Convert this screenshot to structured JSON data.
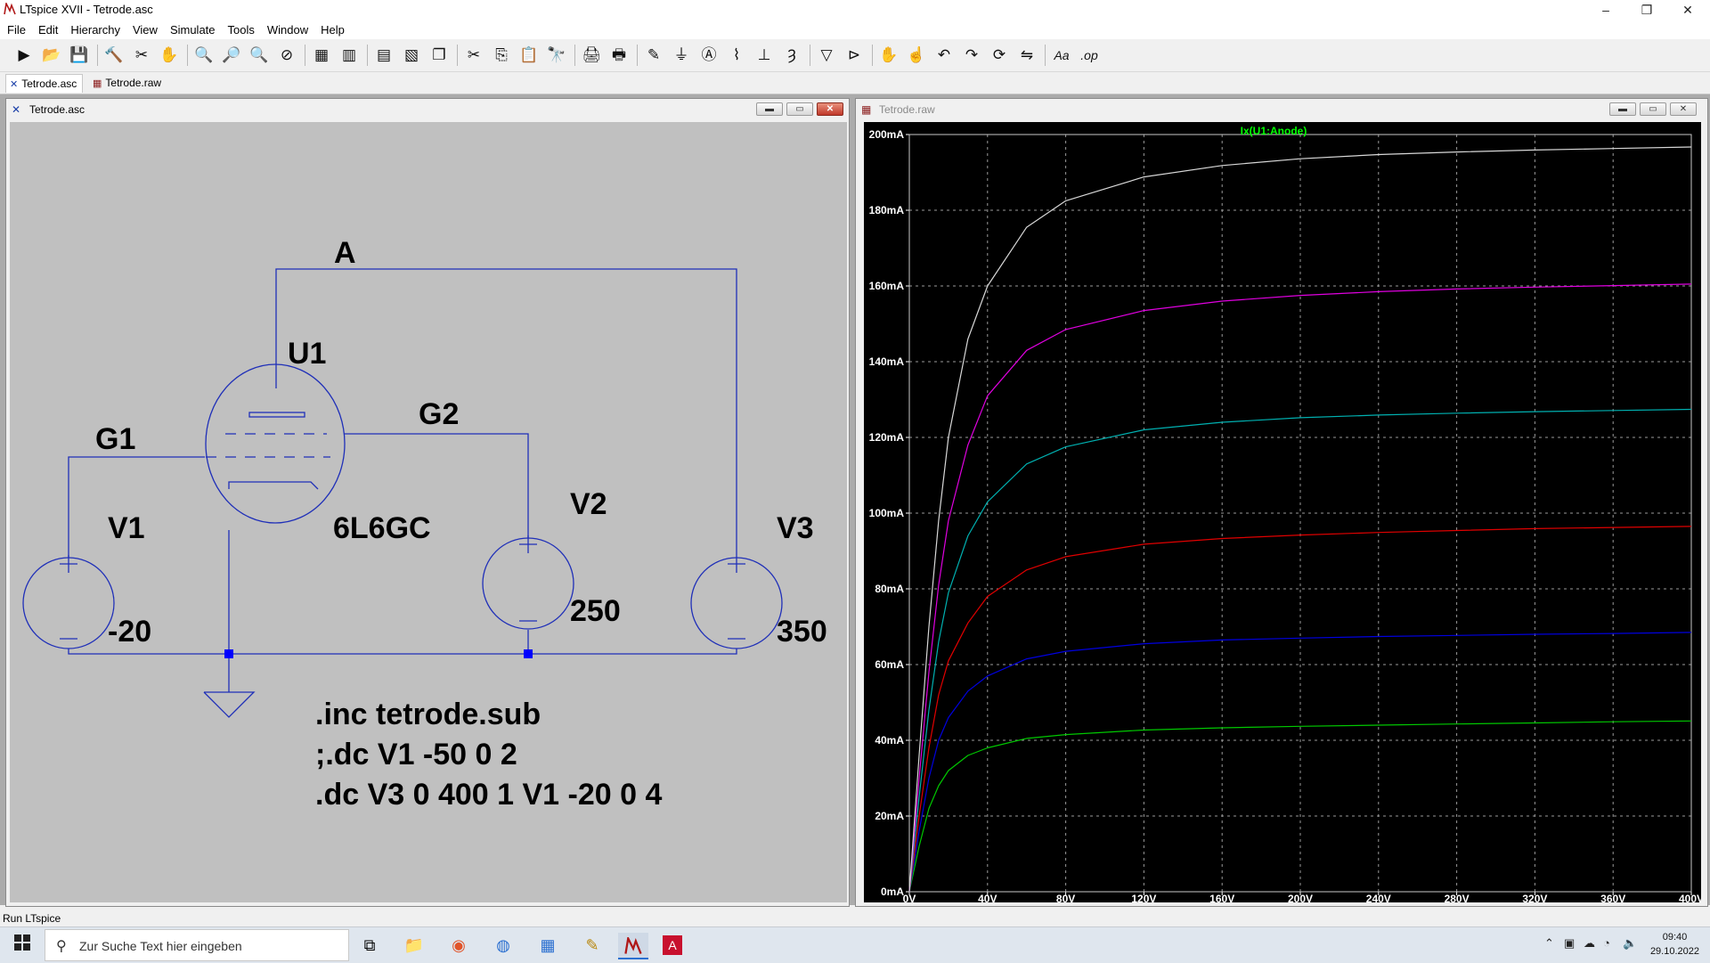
{
  "app": {
    "title": "LTspice XVII - Tetrode.asc",
    "window_controls": {
      "minimize": "–",
      "maximize": "❐",
      "close": "✕"
    }
  },
  "menu": [
    "File",
    "Edit",
    "Hierarchy",
    "View",
    "Simulate",
    "Tools",
    "Window",
    "Help"
  ],
  "toolbar": [
    {
      "name": "run-icon",
      "glyph": "▶"
    },
    {
      "name": "open-icon",
      "glyph": "📂"
    },
    {
      "name": "save-icon",
      "glyph": "💾"
    },
    {
      "name": "control-panel-icon",
      "glyph": "🔨"
    },
    {
      "name": "halt-icon",
      "glyph": "✂"
    },
    {
      "name": "pan-icon",
      "glyph": "✋"
    },
    {
      "name": "zoom-in-icon",
      "glyph": "🔍"
    },
    {
      "name": "zoom-full-icon",
      "glyph": "🔎"
    },
    {
      "name": "zoom-out-icon",
      "glyph": "🔍"
    },
    {
      "name": "zoom-cancel-icon",
      "glyph": "⊘"
    },
    {
      "name": "autorange-icon",
      "glyph": "▦"
    },
    {
      "name": "plot-settings-icon",
      "glyph": "▥"
    },
    {
      "name": "tile-horizontal-icon",
      "glyph": "▤"
    },
    {
      "name": "tile-vertical-icon",
      "glyph": "▧"
    },
    {
      "name": "cascade-icon",
      "glyph": "❐"
    },
    {
      "name": "cut-icon",
      "glyph": "✂"
    },
    {
      "name": "copy-icon",
      "glyph": "⎘"
    },
    {
      "name": "paste-icon",
      "glyph": "📋"
    },
    {
      "name": "find-icon",
      "glyph": "🔭"
    },
    {
      "name": "print-icon",
      "glyph": "🖨"
    },
    {
      "name": "print-preview-icon",
      "glyph": "🖶"
    },
    {
      "name": "wire-icon",
      "glyph": "✎"
    },
    {
      "name": "ground-icon",
      "glyph": "⏚"
    },
    {
      "name": "label-net-icon",
      "glyph": "Ⓐ"
    },
    {
      "name": "resistor-icon",
      "glyph": "⌇"
    },
    {
      "name": "capacitor-icon",
      "glyph": "⊥"
    },
    {
      "name": "inductor-icon",
      "glyph": "Ȝ"
    },
    {
      "name": "diode-icon",
      "glyph": "▽"
    },
    {
      "name": "component-icon",
      "glyph": "⊳"
    },
    {
      "name": "move-icon",
      "glyph": "✋"
    },
    {
      "name": "drag-icon",
      "glyph": "☝"
    },
    {
      "name": "undo-icon",
      "glyph": "↶"
    },
    {
      "name": "redo-icon",
      "glyph": "↷"
    },
    {
      "name": "rotate-icon",
      "glyph": "⟳"
    },
    {
      "name": "mirror-icon",
      "glyph": "⇋"
    },
    {
      "name": "text-icon",
      "glyph": "Aa"
    },
    {
      "name": "spice-directive-icon",
      "glyph": ".op"
    }
  ],
  "tabs": [
    {
      "label": "Tetrode.asc",
      "active": true
    },
    {
      "label": "Tetrode.raw",
      "active": false
    }
  ],
  "schematic": {
    "title": "Tetrode.asc",
    "labels": {
      "A": "A",
      "U1": "U1",
      "G2": "G2",
      "G1": "G1",
      "V1": "V1",
      "V2": "V2",
      "V3": "V3",
      "model": "6L6GC",
      "v1val": "-20",
      "v2val": "250",
      "v3val": "350"
    },
    "directives": [
      ".inc tetrode.sub",
      ";.dc V1 -50 0 2",
      ".dc V3 0 400 1 V1 -20 0 4"
    ],
    "colors": {
      "background": "#c0c0c0",
      "wire": "#1f2fb8",
      "text": "#000000",
      "junction": "#0000ff"
    }
  },
  "plot": {
    "title": "Tetrode.raw",
    "colors": {
      "background": "#000000",
      "grid": "#9a9a9a",
      "axis_text": "#ffffff",
      "trace_label": "#00ff00"
    },
    "chart_data": {
      "type": "line",
      "title": "Ix(U1:Anode)",
      "xlabel": "",
      "ylabel": "",
      "xlim": [
        0,
        400
      ],
      "ylim": [
        0,
        200
      ],
      "x_ticks": [
        "0V",
        "40V",
        "80V",
        "120V",
        "160V",
        "200V",
        "240V",
        "280V",
        "320V",
        "360V",
        "400V"
      ],
      "y_ticks": [
        "0mA",
        "20mA",
        "40mA",
        "60mA",
        "80mA",
        "100mA",
        "120mA",
        "140mA",
        "160mA",
        "180mA",
        "200mA"
      ],
      "grid": true,
      "x": [
        0,
        5,
        10,
        15,
        20,
        30,
        40,
        60,
        80,
        120,
        160,
        200,
        240,
        280,
        320,
        360,
        400
      ],
      "series": [
        {
          "color": "#00c800",
          "values": [
            0,
            12,
            22,
            28,
            32,
            36,
            38,
            40.5,
            41.5,
            42.7,
            43.3,
            43.7,
            44.0,
            44.3,
            44.6,
            44.9,
            45.1
          ]
        },
        {
          "color": "#0000e0",
          "values": [
            0,
            16,
            30,
            40,
            46,
            53,
            57,
            61.5,
            63.5,
            65.5,
            66.5,
            67.0,
            67.4,
            67.7,
            68.0,
            68.2,
            68.5
          ]
        },
        {
          "color": "#e00000",
          "values": [
            0,
            20,
            38,
            52,
            61,
            71,
            78,
            85,
            88.5,
            91.8,
            93.3,
            94.2,
            94.9,
            95.4,
            95.9,
            96.2,
            96.5
          ]
        },
        {
          "color": "#00b0b0",
          "values": [
            0,
            25,
            48,
            66,
            79,
            94,
            103,
            113,
            117.5,
            122,
            124,
            125.2,
            125.9,
            126.4,
            126.8,
            127.1,
            127.4
          ]
        },
        {
          "color": "#e000e0",
          "values": [
            0,
            30,
            58,
            81,
            98,
            118,
            131,
            143,
            148.5,
            153.5,
            156,
            157.5,
            158.5,
            159.2,
            159.7,
            160.1,
            160.5
          ]
        },
        {
          "color": "#d8d8d8",
          "values": [
            0,
            36,
            70,
            98,
            120,
            146,
            160,
            175.5,
            182.5,
            188.8,
            191.8,
            193.6,
            194.7,
            195.4,
            195.9,
            196.3,
            196.7
          ]
        }
      ]
    }
  },
  "status": {
    "text": "Run LTspice"
  },
  "taskbar": {
    "search_placeholder": "Zur Suche Text hier eingeben",
    "time": "09:40",
    "date": "29.10.2022"
  }
}
